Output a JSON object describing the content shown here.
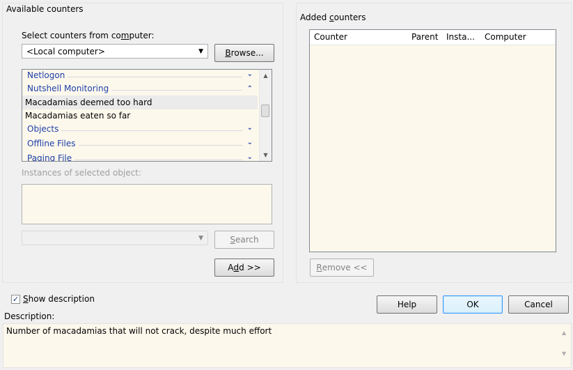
{
  "available": {
    "group_label": "Available counters",
    "select_from_label": "Select counters from computer:",
    "computer_value": "<Local computer>",
    "browse_label": "Browse...",
    "categories": [
      {
        "name": "Netlogon",
        "expanded": false
      },
      {
        "name": "Nutshell Monitoring",
        "expanded": true
      },
      {
        "name": "Objects",
        "expanded": false
      },
      {
        "name": "Offline Files",
        "expanded": false
      },
      {
        "name": "Paging File",
        "expanded": false
      }
    ],
    "counters": [
      {
        "label": "Macadamias deemed too hard",
        "selected": true
      },
      {
        "label": "Macadamias eaten so far",
        "selected": false
      }
    ],
    "instances_label": "Instances of selected object:",
    "search_value": "",
    "search_label": "Search",
    "add_label": "Add >>"
  },
  "added": {
    "group_label": "Added counters",
    "columns": [
      "Counter",
      "Parent",
      "Insta...",
      "Computer"
    ],
    "rows": [],
    "remove_label": "Remove <<"
  },
  "show_description": {
    "label": "Show description",
    "checked": true
  },
  "description": {
    "label": "Description:",
    "text": "Number of macadamias that will not crack, despite much effort"
  },
  "buttons": {
    "help": "Help",
    "ok": "OK",
    "cancel": "Cancel"
  },
  "icons": {
    "checkbox": "checkmark-icon",
    "collapse": "chevron-up-icon",
    "expand": "chevron-down-icon",
    "dropdown": "dropdown-arrow-icon"
  },
  "colors": {
    "list_background": "#fdf8ec",
    "category_text": "#1c3fa8",
    "default_button_border": "#3399ff"
  }
}
